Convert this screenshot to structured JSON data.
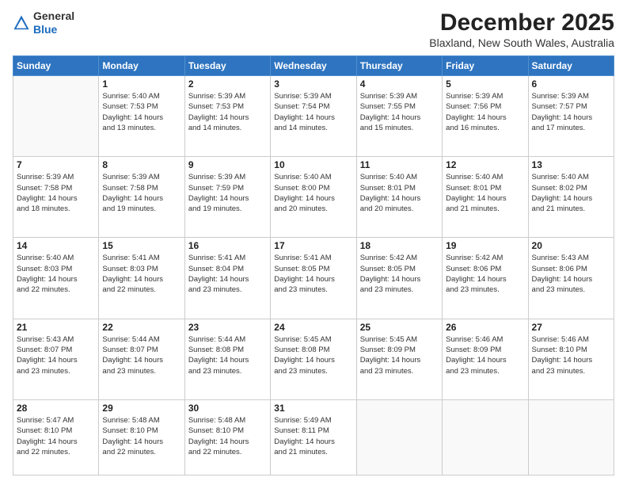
{
  "logo": {
    "general": "General",
    "blue": "Blue"
  },
  "header": {
    "title": "December 2025",
    "subtitle": "Blaxland, New South Wales, Australia"
  },
  "days_of_week": [
    "Sunday",
    "Monday",
    "Tuesday",
    "Wednesday",
    "Thursday",
    "Friday",
    "Saturday"
  ],
  "weeks": [
    [
      {
        "num": "",
        "info": ""
      },
      {
        "num": "1",
        "info": "Sunrise: 5:40 AM\nSunset: 7:53 PM\nDaylight: 14 hours\nand 13 minutes."
      },
      {
        "num": "2",
        "info": "Sunrise: 5:39 AM\nSunset: 7:53 PM\nDaylight: 14 hours\nand 14 minutes."
      },
      {
        "num": "3",
        "info": "Sunrise: 5:39 AM\nSunset: 7:54 PM\nDaylight: 14 hours\nand 14 minutes."
      },
      {
        "num": "4",
        "info": "Sunrise: 5:39 AM\nSunset: 7:55 PM\nDaylight: 14 hours\nand 15 minutes."
      },
      {
        "num": "5",
        "info": "Sunrise: 5:39 AM\nSunset: 7:56 PM\nDaylight: 14 hours\nand 16 minutes."
      },
      {
        "num": "6",
        "info": "Sunrise: 5:39 AM\nSunset: 7:57 PM\nDaylight: 14 hours\nand 17 minutes."
      }
    ],
    [
      {
        "num": "7",
        "info": "Sunrise: 5:39 AM\nSunset: 7:58 PM\nDaylight: 14 hours\nand 18 minutes."
      },
      {
        "num": "8",
        "info": "Sunrise: 5:39 AM\nSunset: 7:58 PM\nDaylight: 14 hours\nand 19 minutes."
      },
      {
        "num": "9",
        "info": "Sunrise: 5:39 AM\nSunset: 7:59 PM\nDaylight: 14 hours\nand 19 minutes."
      },
      {
        "num": "10",
        "info": "Sunrise: 5:40 AM\nSunset: 8:00 PM\nDaylight: 14 hours\nand 20 minutes."
      },
      {
        "num": "11",
        "info": "Sunrise: 5:40 AM\nSunset: 8:01 PM\nDaylight: 14 hours\nand 20 minutes."
      },
      {
        "num": "12",
        "info": "Sunrise: 5:40 AM\nSunset: 8:01 PM\nDaylight: 14 hours\nand 21 minutes."
      },
      {
        "num": "13",
        "info": "Sunrise: 5:40 AM\nSunset: 8:02 PM\nDaylight: 14 hours\nand 21 minutes."
      }
    ],
    [
      {
        "num": "14",
        "info": "Sunrise: 5:40 AM\nSunset: 8:03 PM\nDaylight: 14 hours\nand 22 minutes."
      },
      {
        "num": "15",
        "info": "Sunrise: 5:41 AM\nSunset: 8:03 PM\nDaylight: 14 hours\nand 22 minutes."
      },
      {
        "num": "16",
        "info": "Sunrise: 5:41 AM\nSunset: 8:04 PM\nDaylight: 14 hours\nand 23 minutes."
      },
      {
        "num": "17",
        "info": "Sunrise: 5:41 AM\nSunset: 8:05 PM\nDaylight: 14 hours\nand 23 minutes."
      },
      {
        "num": "18",
        "info": "Sunrise: 5:42 AM\nSunset: 8:05 PM\nDaylight: 14 hours\nand 23 minutes."
      },
      {
        "num": "19",
        "info": "Sunrise: 5:42 AM\nSunset: 8:06 PM\nDaylight: 14 hours\nand 23 minutes."
      },
      {
        "num": "20",
        "info": "Sunrise: 5:43 AM\nSunset: 8:06 PM\nDaylight: 14 hours\nand 23 minutes."
      }
    ],
    [
      {
        "num": "21",
        "info": "Sunrise: 5:43 AM\nSunset: 8:07 PM\nDaylight: 14 hours\nand 23 minutes."
      },
      {
        "num": "22",
        "info": "Sunrise: 5:44 AM\nSunset: 8:07 PM\nDaylight: 14 hours\nand 23 minutes."
      },
      {
        "num": "23",
        "info": "Sunrise: 5:44 AM\nSunset: 8:08 PM\nDaylight: 14 hours\nand 23 minutes."
      },
      {
        "num": "24",
        "info": "Sunrise: 5:45 AM\nSunset: 8:08 PM\nDaylight: 14 hours\nand 23 minutes."
      },
      {
        "num": "25",
        "info": "Sunrise: 5:45 AM\nSunset: 8:09 PM\nDaylight: 14 hours\nand 23 minutes."
      },
      {
        "num": "26",
        "info": "Sunrise: 5:46 AM\nSunset: 8:09 PM\nDaylight: 14 hours\nand 23 minutes."
      },
      {
        "num": "27",
        "info": "Sunrise: 5:46 AM\nSunset: 8:10 PM\nDaylight: 14 hours\nand 23 minutes."
      }
    ],
    [
      {
        "num": "28",
        "info": "Sunrise: 5:47 AM\nSunset: 8:10 PM\nDaylight: 14 hours\nand 22 minutes."
      },
      {
        "num": "29",
        "info": "Sunrise: 5:48 AM\nSunset: 8:10 PM\nDaylight: 14 hours\nand 22 minutes."
      },
      {
        "num": "30",
        "info": "Sunrise: 5:48 AM\nSunset: 8:10 PM\nDaylight: 14 hours\nand 22 minutes."
      },
      {
        "num": "31",
        "info": "Sunrise: 5:49 AM\nSunset: 8:11 PM\nDaylight: 14 hours\nand 21 minutes."
      },
      {
        "num": "",
        "info": ""
      },
      {
        "num": "",
        "info": ""
      },
      {
        "num": "",
        "info": ""
      }
    ]
  ]
}
